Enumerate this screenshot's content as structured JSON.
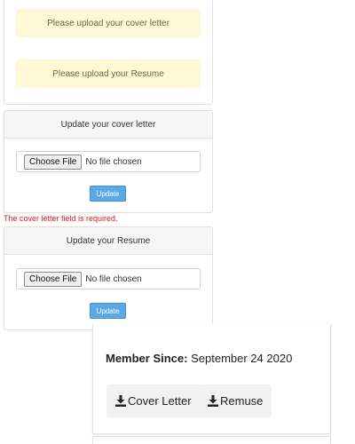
{
  "alerts": {
    "cover_letter": "Please upload your cover letter",
    "resume": "Please upload your Resume"
  },
  "cover_section": {
    "header": "Update your cover letter",
    "choose_label": "Choose File",
    "no_file": "No file chosen",
    "update_label": "Update"
  },
  "error": {
    "message": "The cover letter field is required."
  },
  "resume_section": {
    "header": "Update your Resume",
    "choose_label": "Choose File",
    "no_file": "No file chosen",
    "update_label": "Update"
  },
  "member": {
    "label": "Member Since:",
    "date": "September 24 2020",
    "cover_button": "Cover Letter",
    "resume_button": "Remuse"
  },
  "colors": {
    "alert_bg": "#fff8d6",
    "update_button": "#5aa9e6",
    "error_text": "#e3191c"
  },
  "icons": {
    "download": "download-icon"
  }
}
